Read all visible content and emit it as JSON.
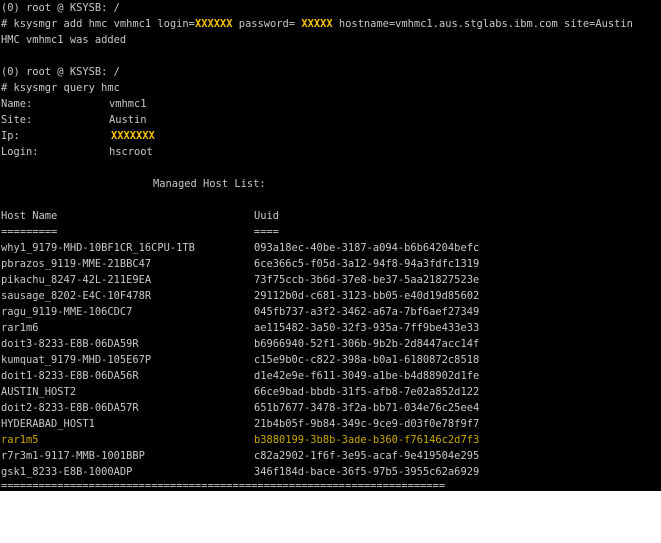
{
  "terminal": {
    "prompt1": "(0) root @ KSYSB: /",
    "cmd_add": {
      "prefix": "# ksysmgr add hmc vmhmc1 login=",
      "login_masked": "XXXXXX",
      "mid": " password= ",
      "password_masked": "XXXXX",
      "suffix": " hostname=vmhmc1.aus.stglabs.ibm.com site=Austin"
    },
    "add_result": "HMC vmhmc1 was added",
    "prompt2": "(0) root @ KSYSB: /",
    "cmd_query": "# ksysmgr query hmc",
    "info": {
      "name_label": "Name:",
      "name_value": "vmhmc1",
      "site_label": "Site:",
      "site_value": "Austin",
      "ip_label": "Ip:",
      "ip_masked": "XXXXXXX",
      "login_label": "Login:",
      "login_value": "hscroot"
    },
    "managed_title": "Managed Host List:",
    "headers": {
      "host": "Host Name",
      "uuid": "Uuid"
    },
    "header_rules": {
      "host": "=========",
      "uuid": "===="
    },
    "hosts": [
      {
        "name": "why1_9179-MHD-10BF1CR_16CPU-1TB",
        "uuid": "093a18ec-40be-3187-a094-b6b64204befc"
      },
      {
        "name": "pbrazos_9119-MME-21BBC47",
        "uuid": "6ce366c5-f05d-3a12-94f8-94a3fdfc1319"
      },
      {
        "name": "pikachu_8247-42L-211E9EA",
        "uuid": "73f75ccb-3b6d-37e8-be37-5aa21827523e"
      },
      {
        "name": "sausage_8202-E4C-10F478R",
        "uuid": "29112b0d-c681-3123-bb05-e40d19d85602"
      },
      {
        "name": "ragu_9119-MME-106CDC7",
        "uuid": "045fb737-a3f2-3462-a67a-7bf6aef27349"
      },
      {
        "name": "rar1m6",
        "uuid": "ae115482-3a50-32f3-935a-7ff9be433e33"
      },
      {
        "name": "doit3-8233-E8B-06DA59R",
        "uuid": "b6966940-52f1-306b-9b2b-2d8447acc14f"
      },
      {
        "name": "kumquat_9179-MHD-105E67P",
        "uuid": "c15e9b0c-c822-398a-b0a1-6180872c8518"
      },
      {
        "name": "doit1-8233-E8B-06DA56R",
        "uuid": "d1e42e9e-f611-3049-a1be-b4d88902d1fe"
      },
      {
        "name": "AUSTIN_HOST2",
        "uuid": "66ce9bad-bbdb-31f5-afb8-7e02a852d122"
      },
      {
        "name": "doit2-8233-E8B-06DA57R",
        "uuid": "651b7677-3478-3f2a-bb71-034e76c25ee4"
      },
      {
        "name": "HYDERABAD_HOST1",
        "uuid": "21b4b05f-9b84-349c-9ce9-d03f0e78f9f7"
      },
      {
        "name": "rar1m5",
        "uuid": "b3880199-3b8b-3ade-b360-f76146c2d7f3"
      },
      {
        "name": "r7r3m1-9117-MMB-1001BBP",
        "uuid": "c82a2902-1f6f-3e95-acaf-9e419504e295"
      },
      {
        "name": "gsk1_8233-E8B-1000ADP",
        "uuid": "346f184d-bace-36f5-97b5-3955c62a6929"
      }
    ],
    "footer_rule": "=======================================================================",
    "colors": {
      "background": "#000000",
      "text": "#c8c8c8",
      "highlight": "#f5c400",
      "selected_row": "#c8a800"
    }
  }
}
